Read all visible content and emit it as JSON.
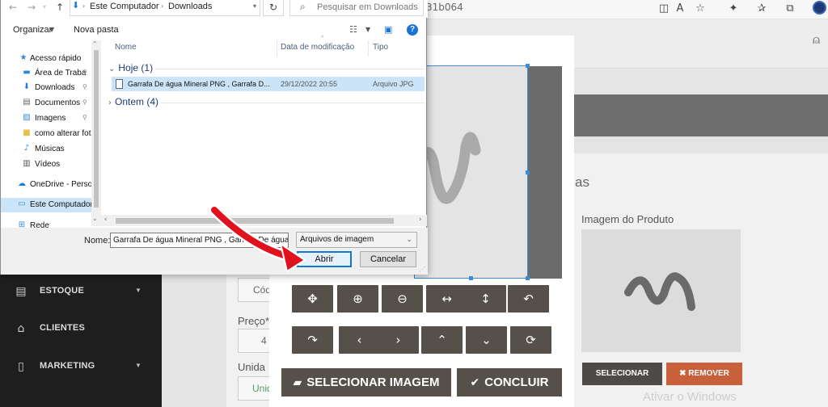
{
  "browser": {
    "url_partial": "31b064",
    "icons": [
      "split-screen-icon",
      "read-aloud-icon",
      "favorite-icon",
      "extensions-icon",
      "favorites-list-icon",
      "collections-icon",
      "profile-icon"
    ]
  },
  "dialog": {
    "nav_back": "←",
    "nav_forward": "→",
    "nav_up": "↑",
    "path": [
      "Este Computador",
      "Downloads"
    ],
    "search_placeholder": "Pesquisar em Downloads",
    "toolbar": {
      "organize": "Organizar",
      "new_folder": "Nova pasta"
    },
    "nav_items": [
      {
        "label": "Acesso rápido",
        "icon": "star-icon",
        "pinned": false
      },
      {
        "label": "Área de Traba",
        "icon": "desktop-icon",
        "pinned": true
      },
      {
        "label": "Downloads",
        "icon": "download-icon",
        "pinned": true
      },
      {
        "label": "Documentos",
        "icon": "document-icon",
        "pinned": true
      },
      {
        "label": "Imagens",
        "icon": "image-icon",
        "pinned": true
      },
      {
        "label": "como alterar fot",
        "icon": "folder-icon",
        "pinned": false
      },
      {
        "label": "Músicas",
        "icon": "music-icon",
        "pinned": false
      },
      {
        "label": "Vídeos",
        "icon": "video-icon",
        "pinned": false
      },
      {
        "label": "OneDrive - Person",
        "icon": "cloud-icon",
        "pinned": false
      },
      {
        "label": "Este Computador",
        "icon": "computer-icon",
        "pinned": false,
        "selected": true
      },
      {
        "label": "Rede",
        "icon": "network-icon",
        "pinned": false
      }
    ],
    "columns": [
      "Nome",
      "Data de modificação",
      "Tipo"
    ],
    "groups": [
      {
        "label": "Hoje (1)",
        "expanded": true
      },
      {
        "label": "Ontem (4)",
        "expanded": false
      }
    ],
    "files": [
      {
        "name": "Garrafa De água Mineral PNG , Garrafa D...",
        "modified": "29/12/2022 20:55",
        "type": "Arquivo JPG"
      }
    ],
    "filename_label": "Nome:",
    "filename_value": "Garrafa De água Mineral PNG , Garrafa De água",
    "filetype": "Arquivos de imagem",
    "open_label": "Abrir",
    "cancel_label": "Cancelar"
  },
  "sidebar": {
    "items": [
      {
        "label": "ESTOQUE",
        "icon": "box-icon",
        "has_submenu": true
      },
      {
        "label": "CLIENTES",
        "icon": "bank-icon",
        "has_submenu": false
      },
      {
        "label": "MARKETING",
        "icon": "bookmark-icon",
        "has_submenu": true
      }
    ]
  },
  "form": {
    "heading_partial": "as",
    "code_label_partial": "Cód",
    "price_label_partial": "Preço*",
    "price_value_partial": "4",
    "unit_label_partial": "Unida",
    "unit_value_partial": "Unid"
  },
  "product": {
    "image_label": "Imagem do Produto",
    "select_label": "SELECIONAR",
    "remove_label": "✖ REMOVER",
    "remove_icon": "✖"
  },
  "cropper": {
    "tools_row1": [
      "move-icon",
      "zoom-in-icon",
      "zoom-out-icon",
      "flip-horizontal-icon",
      "flip-vertical-icon",
      "rotate-left-icon"
    ],
    "tools_row2": [
      "rotate-right-icon",
      "chevron-left-icon",
      "chevron-right-icon",
      "chevron-up-icon",
      "chevron-down-icon",
      "reset-icon"
    ],
    "select_image_label": "SELECIONAR IMAGEM",
    "conclude_label": "CONCLUIR"
  },
  "watermark": "Ativar o Windows",
  "colors": {
    "accent_dark": "#555049",
    "remove_button": "#c9603c",
    "sidebar_bg": "#1e1e1e",
    "selection_blue": "#cce4f7",
    "crop_border": "#3b8bd8",
    "arrow_red": "#e0121e"
  }
}
